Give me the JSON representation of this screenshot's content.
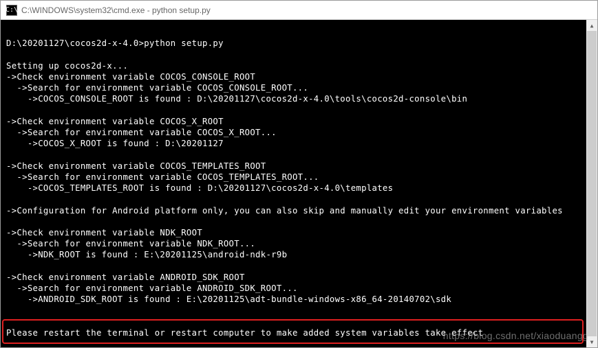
{
  "titlebar": {
    "icon_label": "C:\\",
    "title": "C:\\WINDOWS\\system32\\cmd.exe - python  setup.py"
  },
  "terminal": {
    "lines": [
      "",
      "D:\\20201127\\cocos2d-x-4.0>python setup.py",
      "",
      "Setting up cocos2d-x...",
      "->Check environment variable COCOS_CONSOLE_ROOT",
      "  ->Search for environment variable COCOS_CONSOLE_ROOT...",
      "    ->COCOS_CONSOLE_ROOT is found : D:\\20201127\\cocos2d-x-4.0\\tools\\cocos2d-console\\bin",
      "",
      "->Check environment variable COCOS_X_ROOT",
      "  ->Search for environment variable COCOS_X_ROOT...",
      "    ->COCOS_X_ROOT is found : D:\\20201127",
      "",
      "->Check environment variable COCOS_TEMPLATES_ROOT",
      "  ->Search for environment variable COCOS_TEMPLATES_ROOT...",
      "    ->COCOS_TEMPLATES_ROOT is found : D:\\20201127\\cocos2d-x-4.0\\templates",
      "",
      "->Configuration for Android platform only, you can also skip and manually edit your environment variables",
      "",
      "->Check environment variable NDK_ROOT",
      "  ->Search for environment variable NDK_ROOT...",
      "    ->NDK_ROOT is found : E:\\20201125\\android-ndk-r9b",
      "",
      "->Check environment variable ANDROID_SDK_ROOT",
      "  ->Search for environment variable ANDROID_SDK_ROOT...",
      "    ->ANDROID_SDK_ROOT is found : E:\\20201125\\adt-bundle-windows-x86_64-20140702\\sdk",
      "",
      "",
      "Please restart the terminal or restart computer to make added system variables take effect",
      ""
    ]
  },
  "watermark": {
    "text": "https://blog.csdn.net/xiaoduangg"
  },
  "scrollbar": {
    "up_arrow": "▲",
    "down_arrow": "▼"
  }
}
